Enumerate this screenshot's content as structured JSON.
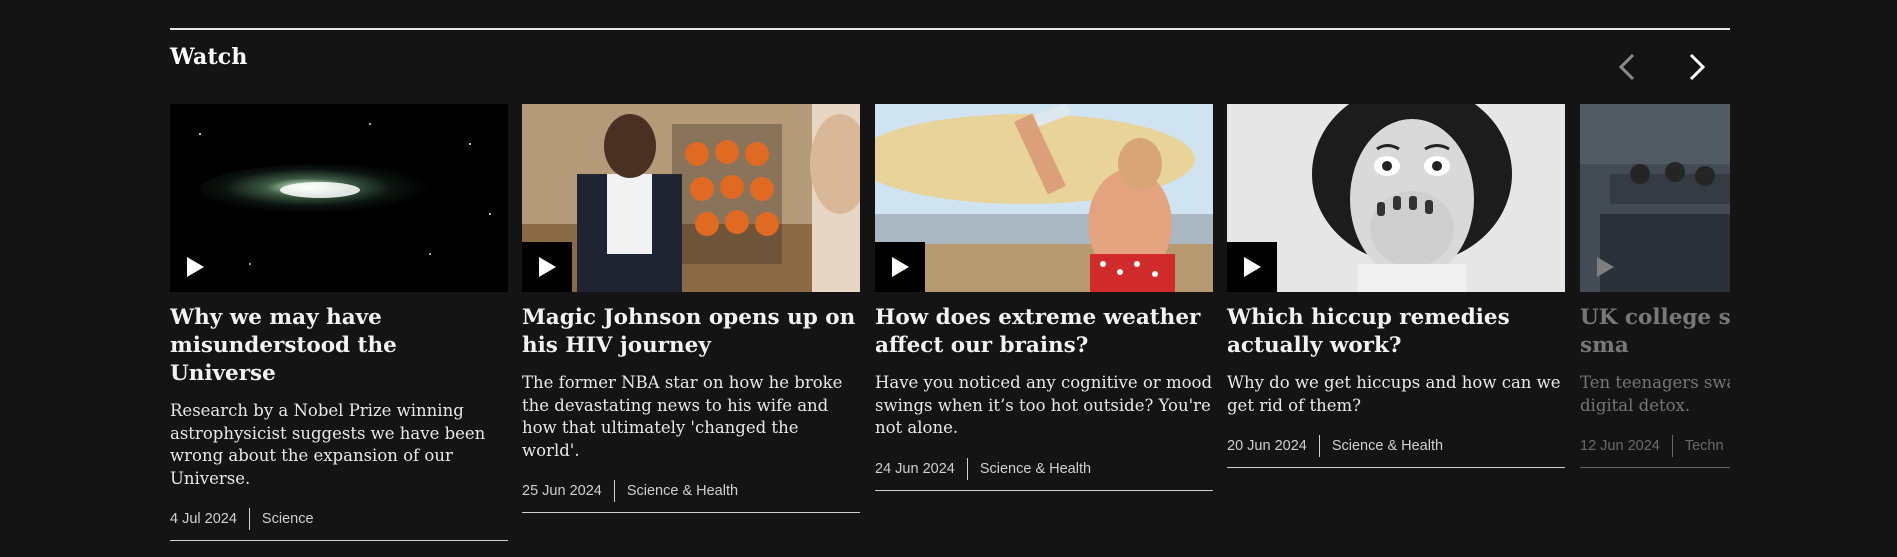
{
  "section": {
    "title": "Watch"
  },
  "nav": {
    "prev_icon": "chevron-left-icon",
    "next_icon": "chevron-right-icon"
  },
  "cards": [
    {
      "title": "Why we may have misunderstood the Universe",
      "summary": "Research by a Nobel Prize winning astrophysicist suggests we have been wrong about the expansion of our Universe.",
      "date": "4 Jul 2024",
      "category": "Science"
    },
    {
      "title": "Magic Johnson opens up on his HIV journey",
      "summary": "The former NBA star on how he broke the devastating news to his wife and how that ultimately 'changed the world'.",
      "date": "25 Jun 2024",
      "category": "Science & Health"
    },
    {
      "title": "How does extreme weather affect our brains?",
      "summary": "Have you noticed any cognitive or mood swings when it’s too hot outside? You're not alone.",
      "date": "24 Jun 2024",
      "category": "Science & Health"
    },
    {
      "title": "Which hiccup remedies actually work?",
      "summary": "Why do we get hiccups and how can we get rid of them?",
      "date": "20 Jun 2024",
      "category": "Science & Health"
    },
    {
      "title": "UK college stu without a sma",
      "summary": "Ten teenagers swa for brick phones a digital detox.",
      "date": "12 Jun 2024",
      "category": "Techn"
    }
  ]
}
